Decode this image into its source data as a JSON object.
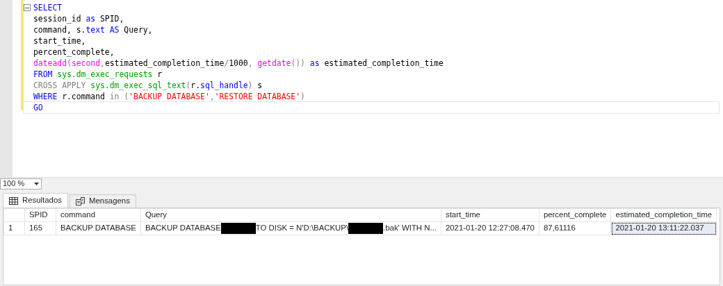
{
  "editor": {
    "lines": [
      [
        {
          "kind": "keyword",
          "text": "SELECT"
        }
      ],
      [
        {
          "kind": "plain",
          "text": "session_id "
        },
        {
          "kind": "keyword",
          "text": "as"
        },
        {
          "kind": "plain",
          "text": " SPID,"
        }
      ],
      [
        {
          "kind": "plain",
          "text": "command, s."
        },
        {
          "kind": "keyword",
          "text": "text"
        },
        {
          "kind": "keyword",
          "text": " AS"
        },
        {
          "kind": "plain",
          "text": " Query,"
        }
      ],
      [
        {
          "kind": "plain",
          "text": "start_time,"
        }
      ],
      [
        {
          "kind": "plain",
          "text": "percent_complete,"
        }
      ],
      [
        {
          "kind": "function",
          "text": "dateadd"
        },
        {
          "kind": "operator",
          "text": "("
        },
        {
          "kind": "function",
          "text": "second"
        },
        {
          "kind": "operator",
          "text": ","
        },
        {
          "kind": "plain",
          "text": "estimated_completion_time"
        },
        {
          "kind": "operator",
          "text": "/"
        },
        {
          "kind": "plain",
          "text": "1000"
        },
        {
          "kind": "operator",
          "text": ", "
        },
        {
          "kind": "function",
          "text": "getdate"
        },
        {
          "kind": "operator",
          "text": "())"
        },
        {
          "kind": "keyword",
          "text": " as"
        },
        {
          "kind": "plain",
          "text": " estimated_completion_time"
        }
      ],
      [
        {
          "kind": "keyword",
          "text": "FROM"
        },
        {
          "kind": "system",
          "text": " sys.dm_exec_requests"
        },
        {
          "kind": "plain",
          "text": " r"
        }
      ],
      [
        {
          "kind": "operator",
          "text": "CROSS APPLY"
        },
        {
          "kind": "system",
          "text": " sys.dm_exec_sql_text"
        },
        {
          "kind": "operator",
          "text": "("
        },
        {
          "kind": "plain",
          "text": "r."
        },
        {
          "kind": "keyword",
          "text": "sql_handle"
        },
        {
          "kind": "operator",
          "text": ")"
        },
        {
          "kind": "plain",
          "text": " s"
        }
      ],
      [
        {
          "kind": "keyword",
          "text": "WHERE"
        },
        {
          "kind": "plain",
          "text": " r.command "
        },
        {
          "kind": "operator",
          "text": "in ("
        },
        {
          "kind": "string",
          "text": "'BACKUP DATABASE'"
        },
        {
          "kind": "operator",
          "text": ","
        },
        {
          "kind": "string",
          "text": "'RESTORE DATABASE'"
        },
        {
          "kind": "operator",
          "text": ")"
        }
      ],
      [
        {
          "kind": "keyword",
          "text": "GO"
        }
      ]
    ]
  },
  "zoom": {
    "value": "100 %"
  },
  "tabs": [
    {
      "label": "Resultados",
      "selected": true
    },
    {
      "label": "Mensagens",
      "selected": false
    }
  ],
  "grid": {
    "columns": [
      "SPID",
      "command",
      "Query",
      "start_time",
      "percent_complete",
      "estimated_completion_time"
    ],
    "rows": [
      {
        "number": "1",
        "cells": [
          {
            "selected": false,
            "parts": [
              {
                "kind": "text",
                "text": "165"
              }
            ]
          },
          {
            "selected": false,
            "parts": [
              {
                "kind": "text",
                "text": "BACKUP DATABASE"
              }
            ]
          },
          {
            "selected": false,
            "parts": [
              {
                "kind": "text",
                "text": "BACKUP DATABASE"
              },
              {
                "kind": "redacted"
              },
              {
                "kind": "text",
                "text": "TO  DISK = N'D:\\BACKUP\\"
              },
              {
                "kind": "redacted"
              },
              {
                "kind": "text",
                "text": ".bak'  WITH N..."
              }
            ]
          },
          {
            "selected": false,
            "parts": [
              {
                "kind": "text",
                "text": "2021-01-20 12:27:08.470"
              }
            ]
          },
          {
            "selected": false,
            "parts": [
              {
                "kind": "text",
                "text": "87,61116"
              }
            ]
          },
          {
            "selected": true,
            "parts": [
              {
                "kind": "text",
                "text": "2021-01-20 13:11:22.037"
              }
            ]
          }
        ]
      }
    ]
  }
}
